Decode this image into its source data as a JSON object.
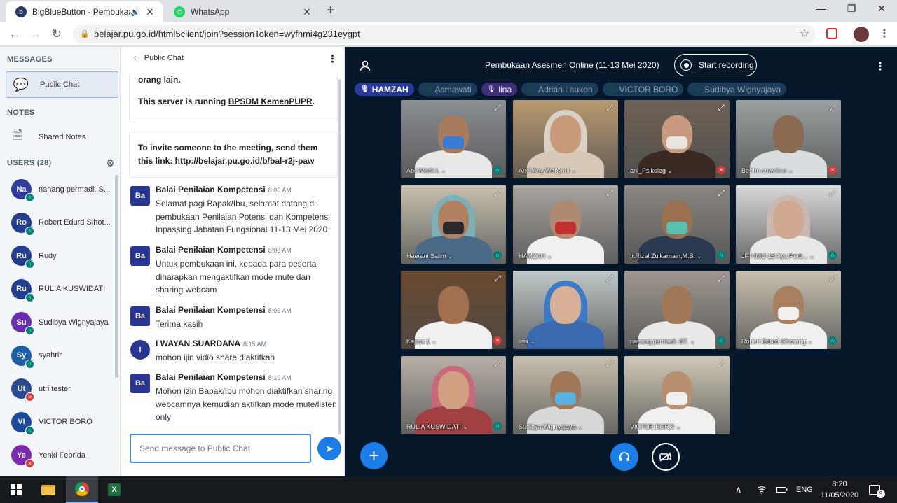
{
  "browser": {
    "tabs": [
      {
        "title": "BigBlueButton - Pembukaan",
        "active": true
      },
      {
        "title": "WhatsApp",
        "active": false
      }
    ],
    "url": "belajar.pu.go.id/html5client/join?sessionToken=wyfhmi4g231eygpt"
  },
  "sidebar": {
    "messages_heading": "MESSAGES",
    "public_chat_label": "Public Chat",
    "notes_heading": "NOTES",
    "shared_notes_label": "Shared Notes",
    "users_heading": "USERS (28)",
    "users": [
      {
        "initials": "Na",
        "name": "nanang permadi. S...",
        "color": "#2f3c9e",
        "status": "listen"
      },
      {
        "initials": "Ro",
        "name": "Robert Edurd Sihot...",
        "color": "#233d8f",
        "status": "listen"
      },
      {
        "initials": "Ru",
        "name": "Rudy",
        "color": "#233d8f",
        "status": "listen"
      },
      {
        "initials": "Ru",
        "name": "RULIA KUSWIDATI",
        "color": "#233d8f",
        "status": "listen"
      },
      {
        "initials": "Su",
        "name": "Sudibya Wignyajaya",
        "color": "#6a2cb0",
        "status": "listen"
      },
      {
        "initials": "Sy",
        "name": "syahrir",
        "color": "#1b5fa8",
        "status": "listen"
      },
      {
        "initials": "Ut",
        "name": "utri tester",
        "color": "#2a4a8f",
        "status": "muted"
      },
      {
        "initials": "VI",
        "name": "VICTOR BORO",
        "color": "#1b4a9a",
        "status": "listen"
      },
      {
        "initials": "Ye",
        "name": "Yenki Febrida",
        "color": "#7a2bb0",
        "status": "muted"
      }
    ]
  },
  "chat": {
    "header": "Public Chat",
    "sys_partial_line": "orang lain.",
    "server_prefix": "This server is running ",
    "server_link": "BPSDM KemenPUPR",
    "server_suffix": ".",
    "invite_text": "To invite someone to the meeting, send them this link: http://belajar.pu.go.id/b/bal-r2j-paw",
    "messages": [
      {
        "avatar": "Ba",
        "sender": "Balai Penilaian Kompetensi",
        "time": "8:05 AM",
        "text": "Selamat pagi Bapak/Ibu, selamat datang di pembukaan Penilaian Potensi dan Kompetensi Inpassing Jabatan Fungsional 11-13 Mei 2020"
      },
      {
        "avatar": "Ba",
        "sender": "Balai Penilaian Kompetensi",
        "time": "8:06 AM",
        "text": "Untuk pembukaan ini, kepada para peserta diharapkan mengaktifkan mode mute dan sharing webcam"
      },
      {
        "avatar": "Ba",
        "sender": "Balai Penilaian Kompetensi",
        "time": "8:06 AM",
        "text": "Terima kasih"
      },
      {
        "avatar": "I",
        "sender": "I WAYAN SUARDANA",
        "time": "8:15 AM",
        "text": "mohon ijin vidio share diaktifkan"
      },
      {
        "avatar": "Ba",
        "sender": "Balai Penilaian Kompetensi",
        "time": "8:19 AM",
        "text": "Mohon izin Bapak/Ibu mohon diaktifkan sharing webcamnya kemudian aktifkan mode mute/listen only"
      }
    ],
    "input_placeholder": "Send message to Public Chat"
  },
  "main": {
    "meeting_title": "Pembukaan Asesmen Online (11-13 Mei 2020)",
    "record_label": "Start recording",
    "talkers": [
      {
        "name": "HAMZAH",
        "state": "on"
      },
      {
        "name": "Asmawati",
        "state": "off"
      },
      {
        "name": "lina",
        "state": "purple"
      },
      {
        "name": "Adrian Laukon",
        "state": "off"
      },
      {
        "name": "VICTOR BORO",
        "state": "off"
      },
      {
        "name": "Sudibya Wignyajaya",
        "state": "off"
      }
    ],
    "videos": [
      {
        "label": "Abd Malik L",
        "status": "listen",
        "bg": "#8b8f93",
        "skin": "#a87b5c",
        "shirt": "#e8e8e8",
        "mask": "#3a7bd5"
      },
      {
        "label": "Andi Any Wahyuni",
        "status": "none",
        "bg": "#b89a70",
        "skin": "#c79a7a",
        "shirt": "#d8c8b8",
        "hijab": "#d9d0c8"
      },
      {
        "label": "ani_Psikolog",
        "status": "muted",
        "bg": "#6e6256",
        "skin": "#c99a80",
        "shirt": "#3b2a24",
        "mask": "#e8e4e0"
      },
      {
        "label": "Bertho sowolino",
        "status": "muted",
        "bg": "#9aa0a0",
        "skin": "#8a6a50",
        "shirt": "#d8dde0"
      },
      {
        "label": "Haerani Salim",
        "status": "listen",
        "bg": "#c8c0b0",
        "skin": "#b08060",
        "shirt": "#4a6a88",
        "hijab": "#7ab0b8",
        "mask": "#2a2a2a"
      },
      {
        "label": "HAMZAH",
        "status": "none",
        "bg": "#a8a49e",
        "skin": "#b08a70",
        "shirt": "#f0f0f0",
        "mask": "#c03030"
      },
      {
        "label": "Ir.Rizal Zulkarnain,M.Si",
        "status": "listen",
        "bg": "#8a8680",
        "skin": "#9a7050",
        "shirt": "#2a3a50",
        "mask": "#58c0b0"
      },
      {
        "label": "JFT-IMU-18-Ayu Perti...",
        "status": "listen",
        "bg": "#d8d8d8",
        "skin": "#d0a890",
        "shirt": "#e8e8e8",
        "hijab": "#c8b8b0"
      },
      {
        "label": "Kapus 1",
        "status": "muted",
        "bg": "#6a4a30",
        "skin": "#a07050",
        "shirt": "#f0f0f0"
      },
      {
        "label": "lina",
        "status": "none",
        "bg": "#c0c8c8",
        "skin": "#d8b098",
        "shirt": "#3a6ab0",
        "hijab": "#3a7ac8"
      },
      {
        "label": "nanang permadi. ST.",
        "status": "listen",
        "bg": "#a09890",
        "skin": "#a07858",
        "shirt": "#e8e8e8"
      },
      {
        "label": "Robert Edurd Sihotang",
        "status": "listen",
        "bg": "#c8c0b0",
        "skin": "#a88060",
        "shirt": "#f0f0f0",
        "mask": "#f0f0f0"
      },
      {
        "label": "RULIA KUSWIDATI",
        "status": "listen",
        "bg": "#b8b0a8",
        "skin": "#d0a080",
        "shirt": "#a04040",
        "hijab": "#c86878"
      },
      {
        "label": "Sudibya Wignyajaya",
        "status": "none",
        "bg": "#c8c0b0",
        "skin": "#a07858",
        "shirt": "#d8d8d8",
        "mask": "#5ab0e0"
      },
      {
        "label": "VICTOR BORO",
        "status": "none",
        "bg": "#d0c8b8",
        "skin": "#b89070",
        "shirt": "#f0f0f0",
        "mask": "#f0f0f0"
      }
    ]
  },
  "taskbar": {
    "lang": "ENG",
    "time": "8:20",
    "date": "11/05/2020",
    "notifications": "9"
  }
}
